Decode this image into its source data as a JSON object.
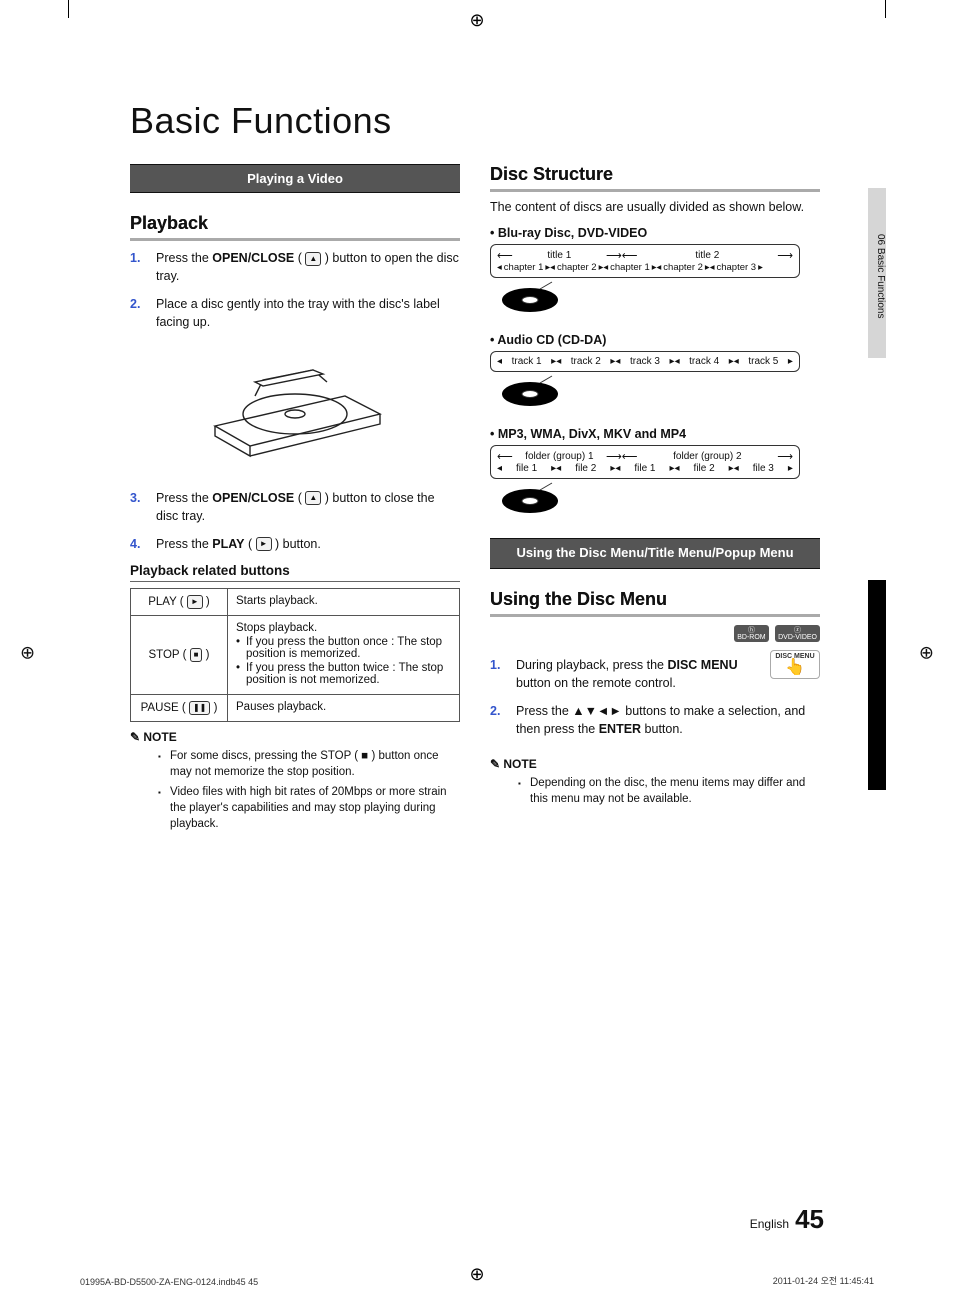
{
  "title": "Basic Functions",
  "side_tab": "06    Basic Functions",
  "banner1": "Playing a Video",
  "playback_heading": "Playback",
  "steps_play": [
    {
      "n": "1.",
      "pre": "Press the ",
      "b": "OPEN/CLOSE",
      "post_icon": "▲",
      "post": " button to open the disc tray."
    },
    {
      "n": "2.",
      "text": "Place a disc gently into the tray with the disc's label facing up."
    },
    {
      "n": "3.",
      "pre": "Press the ",
      "b": "OPEN/CLOSE",
      "post_icon": "▲",
      "post": " button to close the disc tray."
    },
    {
      "n": "4.",
      "pre": "Press the ",
      "b": "PLAY",
      "post_icon": "►",
      "post": " button."
    }
  ],
  "sub_pb": "Playback related buttons",
  "pb_table": [
    {
      "btn": "PLAY",
      "icon": "►",
      "desc": "Starts playback."
    },
    {
      "btn": "STOP",
      "icon": "■",
      "desc_main": "Stops playback.",
      "bul": [
        "If you press the button once : The stop position is memorized.",
        "If you press the button twice : The stop position is not memorized."
      ]
    },
    {
      "btn": "PAUSE",
      "icon": "❚❚",
      "desc": "Pauses playback."
    }
  ],
  "note_label": "NOTE",
  "notes_left": [
    "For some discs, pressing the STOP ( ■ ) button once may not memorize the stop position.",
    "Video files with high bit rates of 20Mbps or more strain the player's capabilities and may stop playing during playback."
  ],
  "disc_structure_heading": "Disc Structure",
  "disc_structure_para": "The content of discs are usually divided as shown below.",
  "ds_bd": "Blu-ray Disc, DVD-VIDEO",
  "ds_bd_titles": [
    "title 1",
    "title 2"
  ],
  "ds_bd_chapters": [
    "chapter 1",
    "chapter 2",
    "chapter 1",
    "chapter 2",
    "chapter 3"
  ],
  "ds_cd": "Audio CD (CD-DA)",
  "ds_cd_tracks": [
    "track 1",
    "track 2",
    "track 3",
    "track 4",
    "track 5"
  ],
  "ds_file": "MP3, WMA, DivX, MKV and MP4",
  "ds_file_folders": [
    "folder (group) 1",
    "folder (group) 2"
  ],
  "ds_file_files": [
    "file 1",
    "file 2",
    "file 1",
    "file 2",
    "file 3"
  ],
  "banner2": "Using the Disc Menu/Title Menu/Popup Menu",
  "using_disc_menu": "Using the Disc Menu",
  "badges": [
    "h\nBD-ROM",
    "z\nDVD-VIDEO"
  ],
  "remote_label": "DISC MENU",
  "steps_dm": [
    {
      "n": "1.",
      "pre": "During playback, press the ",
      "b": "DISC MENU",
      "post": " button on the remote control."
    },
    {
      "n": "2.",
      "pre": "Press the ",
      "b": "▲▼◄►",
      "post": " buttons to make a selection, and then press the ",
      "b2": "ENTER",
      "post2": " button."
    }
  ],
  "notes_right": [
    "Depending on the disc, the menu items may differ and this menu may not be available."
  ],
  "footer_lang": "English",
  "footer_page": "45",
  "printfoot_l": "01995A-BD-D5500-ZA-ENG-0124.indb45   45",
  "printfoot_r": "2011-01-24   오전 11:45:41"
}
